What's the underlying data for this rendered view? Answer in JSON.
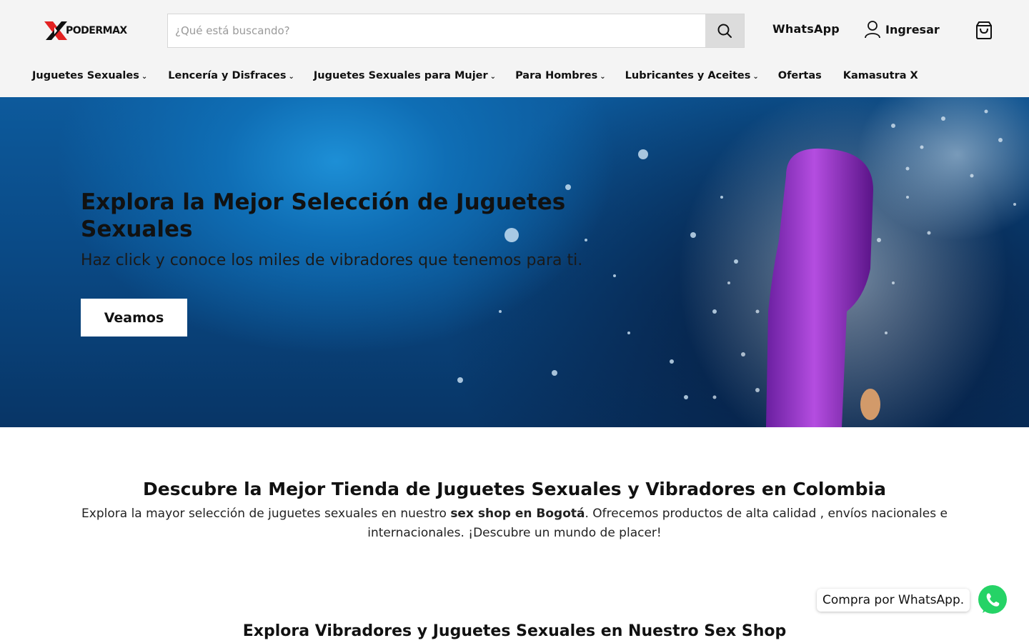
{
  "header": {
    "logo_text_a": "PODER",
    "logo_text_b": "MAX",
    "search_placeholder": "¿Qué está buscando?",
    "whatsapp_label": "WhatsApp",
    "login_label": "Ingresar"
  },
  "nav": {
    "items": [
      {
        "label": "Juguetes Sexuales",
        "dropdown": true
      },
      {
        "label": "Lencería y Disfraces",
        "dropdown": true
      },
      {
        "label": "Juguetes Sexuales para Mujer",
        "dropdown": true
      },
      {
        "label": "Para Hombres",
        "dropdown": true
      },
      {
        "label": "Lubricantes y Aceites",
        "dropdown": true
      },
      {
        "label": "Ofertas",
        "dropdown": false
      },
      {
        "label": "Kamasutra X",
        "dropdown": false
      }
    ]
  },
  "hero": {
    "title": "Explora la Mejor Selección de Juguetes Sexuales",
    "subtitle": "Haz click y conoce los miles de vibradores que tenemos para ti.",
    "button_label": "Veamos"
  },
  "intro": {
    "title": "Descubre la Mejor Tienda de Juguetes Sexuales y Vibradores en Colombia",
    "text_before": "Explora la mayor selección de juguetes sexuales en nuestro ",
    "text_bold": "sex shop en Bogotá",
    "text_after": ". Ofrecemos productos de alta calidad , envíos nacionales e internacionales. ¡Descubre un mundo de placer!"
  },
  "section": {
    "title": "Explora Vibradores y Juguetes Sexuales en Nuestro Sex Shop"
  },
  "whatsapp_float": {
    "label": "Compra por WhatsApp."
  },
  "colors": {
    "header_bg": "#f4f4f4",
    "whatsapp_green": "#25d366",
    "hero_blue": "#0f6eb5"
  }
}
